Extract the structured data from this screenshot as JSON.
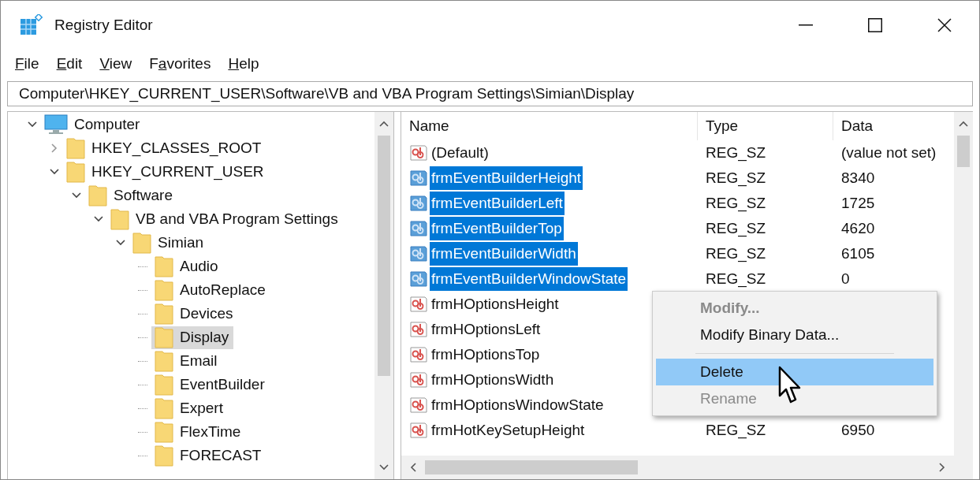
{
  "window": {
    "title": "Registry Editor"
  },
  "menu": [
    {
      "parts": [
        {
          "text": "F",
          "underlined": true
        },
        {
          "text": "ile",
          "underlined": false
        }
      ]
    },
    {
      "parts": [
        {
          "text": "E",
          "underlined": true
        },
        {
          "text": "dit",
          "underlined": false
        }
      ]
    },
    {
      "parts": [
        {
          "text": "V",
          "underlined": true
        },
        {
          "text": "iew",
          "underlined": false
        }
      ]
    },
    {
      "parts": [
        {
          "text": "F",
          "underlined": false
        },
        {
          "text": "a",
          "underlined": true
        },
        {
          "text": "vorites",
          "underlined": false
        }
      ]
    },
    {
      "parts": [
        {
          "text": "H",
          "underlined": true
        },
        {
          "text": "elp",
          "underlined": false
        }
      ]
    }
  ],
  "address": "Computer\\HKEY_CURRENT_USER\\Software\\VB and VBA Program Settings\\Simian\\Display",
  "tree": [
    {
      "label": "Computer",
      "kind": "computer",
      "expanded": true,
      "selected": false,
      "children": [
        {
          "label": "HKEY_CLASSES_ROOT",
          "kind": "folder",
          "expanded": false,
          "selected": false
        },
        {
          "label": "HKEY_CURRENT_USER",
          "kind": "folder",
          "expanded": true,
          "selected": false,
          "children": [
            {
              "label": "Software",
              "kind": "folder",
              "expanded": true,
              "selected": false,
              "children": [
                {
                  "label": "VB and VBA Program Settings",
                  "kind": "folder",
                  "expanded": true,
                  "selected": false,
                  "children": [
                    {
                      "label": "Simian",
                      "kind": "folder",
                      "expanded": true,
                      "selected": false,
                      "children": [
                        {
                          "label": "Audio",
                          "kind": "folder",
                          "selected": false
                        },
                        {
                          "label": "AutoReplace",
                          "kind": "folder",
                          "selected": false
                        },
                        {
                          "label": "Devices",
                          "kind": "folder",
                          "selected": false
                        },
                        {
                          "label": "Display",
                          "kind": "folder",
                          "selected": true
                        },
                        {
                          "label": "Email",
                          "kind": "folder",
                          "selected": false
                        },
                        {
                          "label": "EventBuilder",
                          "kind": "folder",
                          "selected": false
                        },
                        {
                          "label": "Expert",
                          "kind": "folder",
                          "selected": false
                        },
                        {
                          "label": "FlexTime",
                          "kind": "folder",
                          "selected": false
                        },
                        {
                          "label": "FORECAST",
                          "kind": "folder",
                          "selected": false
                        }
                      ]
                    }
                  ]
                }
              ]
            }
          ]
        }
      ]
    }
  ],
  "table": {
    "columns": [
      "Name",
      "Type",
      "Data"
    ],
    "rows": [
      {
        "name": "(Default)",
        "type": "REG_SZ",
        "data": "(value not set)",
        "selected": false
      },
      {
        "name": "frmEventBuilderHeight",
        "type": "REG_SZ",
        "data": "8340",
        "selected": true
      },
      {
        "name": "frmEventBuilderLeft",
        "type": "REG_SZ",
        "data": "1725",
        "selected": true
      },
      {
        "name": "frmEventBuilderTop",
        "type": "REG_SZ",
        "data": "4620",
        "selected": true
      },
      {
        "name": "frmEventBuilderWidth",
        "type": "REG_SZ",
        "data": "6105",
        "selected": true
      },
      {
        "name": "frmEventBuilderWindowState",
        "type": "REG_SZ",
        "data": "0",
        "selected": true
      },
      {
        "name": "frmHOptionsHeight",
        "selected": false
      },
      {
        "name": "frmHOptionsLeft",
        "selected": false
      },
      {
        "name": "frmHOptionsTop",
        "selected": false
      },
      {
        "name": "frmHOptionsWidth",
        "selected": false
      },
      {
        "name": "frmHOptionsWindowState",
        "selected": false
      },
      {
        "name": "frmHotKeySetupHeight",
        "type": "REG_SZ",
        "data": "6950",
        "selected": false
      }
    ]
  },
  "context_menu": [
    {
      "kind": "item",
      "label": "Modify...",
      "bold": true,
      "disabled": true,
      "selected": false
    },
    {
      "kind": "item",
      "label": "Modify Binary Data...",
      "bold": false,
      "disabled": false,
      "selected": false
    },
    {
      "kind": "separator"
    },
    {
      "kind": "item",
      "label": "Delete",
      "bold": false,
      "disabled": false,
      "selected": true
    },
    {
      "kind": "item",
      "label": "Rename",
      "bold": false,
      "disabled": true,
      "selected": false
    }
  ]
}
